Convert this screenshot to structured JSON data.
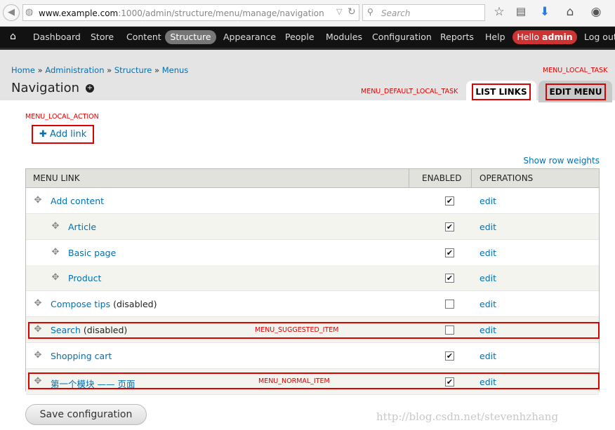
{
  "browser": {
    "url_host": "www.example.com",
    "url_rest": ":1000/admin/structure/menu/manage/navigation",
    "search_placeholder": "Search"
  },
  "toolbar": {
    "items": [
      "Dashboard",
      "Store",
      "Content",
      "Structure",
      "Appearance",
      "People",
      "Modules",
      "Configuration",
      "Reports",
      "Help"
    ],
    "hello": "Hello ",
    "user": "admin",
    "logout": "Log out"
  },
  "header": {
    "breadcrumb": [
      "Home",
      "Administration",
      "Structure",
      "Menus"
    ],
    "separator": " » ",
    "title": "Navigation",
    "annotation_local_task": "MENU_LOCAL_TASK",
    "annotation_default_task": "MENU_DEFAULT_LOCAL_TASK",
    "tab_list": "LIST LINKS",
    "tab_edit": "EDIT MENU"
  },
  "content": {
    "annotation_local_action": "MENU_LOCAL_ACTION",
    "add_link": "Add link",
    "show_row_weights": "Show row weights",
    "columns": [
      "MENU LINK",
      "ENABLED",
      "OPERATIONS"
    ],
    "rows": [
      {
        "label": "Add content",
        "note": "",
        "indent": 0,
        "enabled": true,
        "op": "edit"
      },
      {
        "label": "Article",
        "note": "",
        "indent": 1,
        "enabled": true,
        "op": "edit"
      },
      {
        "label": "Basic page",
        "note": "",
        "indent": 1,
        "enabled": true,
        "op": "edit"
      },
      {
        "label": "Product",
        "note": "",
        "indent": 1,
        "enabled": true,
        "op": "edit"
      },
      {
        "label": "Compose tips",
        "note": " (disabled)",
        "indent": 0,
        "enabled": false,
        "op": "edit"
      },
      {
        "label": "Search",
        "note": " (disabled)",
        "indent": 0,
        "enabled": false,
        "op": "edit"
      },
      {
        "label": "Shopping cart",
        "note": "",
        "indent": 0,
        "enabled": true,
        "op": "edit"
      },
      {
        "label": "第一个模块 —— 页面",
        "note": "",
        "indent": 0,
        "enabled": true,
        "op": "edit"
      }
    ],
    "annotation_suggested": "MENU_SUGGESTED_ITEM",
    "annotation_normal": "MENU_NORMAL_ITEM",
    "save_button": "Save configuration"
  },
  "watermark": "http://blog.csdn.net/stevenhzhang",
  "colors": {
    "link": "#0071b3",
    "annotation": "#dd0000",
    "toolbar_bg": "#121212",
    "hello_bg": "#cc3333"
  }
}
